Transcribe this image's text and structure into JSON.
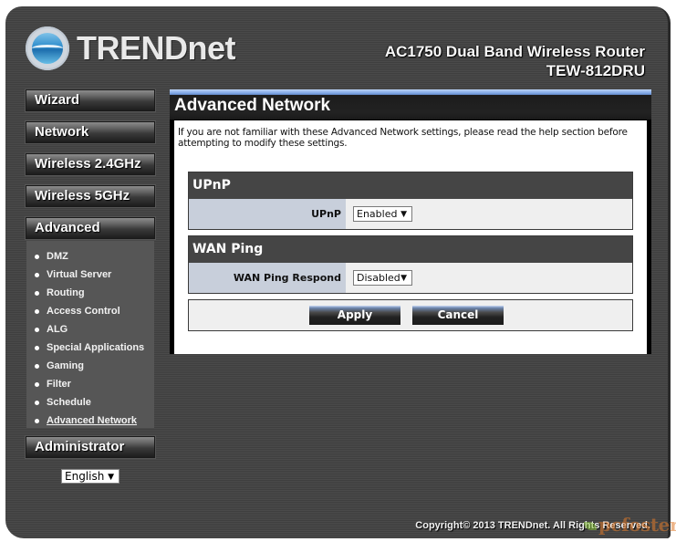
{
  "header": {
    "brand": "TRENDnet",
    "product_line": "AC1750 Dual Band Wireless Router",
    "model": "TEW-812DRU"
  },
  "sidebar": {
    "menu": [
      {
        "label": "Wizard"
      },
      {
        "label": "Network"
      },
      {
        "label": "Wireless 2.4GHz"
      },
      {
        "label": "Wireless 5GHz"
      },
      {
        "label": "Advanced"
      }
    ],
    "advanced_items": [
      {
        "label": "DMZ"
      },
      {
        "label": "Virtual Server"
      },
      {
        "label": "Routing"
      },
      {
        "label": "Access Control"
      },
      {
        "label": "ALG"
      },
      {
        "label": "Special Applications"
      },
      {
        "label": "Gaming"
      },
      {
        "label": "Filter"
      },
      {
        "label": "Schedule"
      },
      {
        "label": "Advanced Network",
        "active": true
      }
    ],
    "administrator": "Administrator",
    "language": {
      "selected": "English",
      "icon": "triangle-down"
    }
  },
  "main": {
    "title": "Advanced Network",
    "intro": "If you are not familiar with these Advanced Network settings, please read the help section before attempting to modify these settings.",
    "upnp": {
      "heading": "UPnP",
      "label": "UPnP",
      "value": "Enabled"
    },
    "wan_ping": {
      "heading": "WAN Ping",
      "label": "WAN Ping Respond",
      "value": "Disabled"
    },
    "buttons": {
      "apply": "Apply",
      "cancel": "Cancel"
    }
  },
  "footer": {
    "copyright": "Copyright© 2013 TRENDnet. All Rights Reserved.",
    "watermark": "pcfoster"
  },
  "colors": {
    "accent_blue": "#7ea6e6",
    "label_bg": "#c8cfdb",
    "section_header": "#454545"
  }
}
